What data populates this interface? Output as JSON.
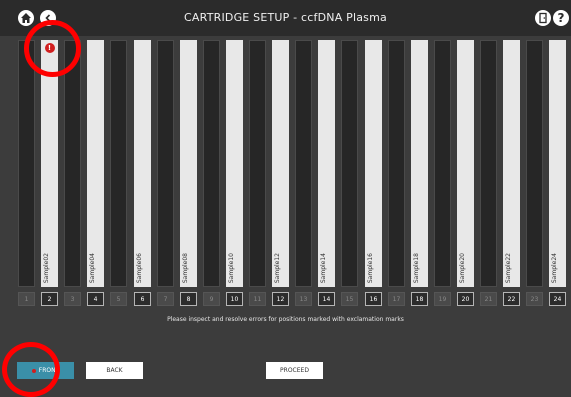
{
  "header": {
    "title": "CARTRIDGE SETUP - ccfDNA Plasma"
  },
  "lanes": [
    {
      "position": "1",
      "label": ""
    },
    {
      "position": "2",
      "label": "Sample02",
      "error": true
    },
    {
      "position": "3",
      "label": ""
    },
    {
      "position": "4",
      "label": "Sample04"
    },
    {
      "position": "5",
      "label": ""
    },
    {
      "position": "6",
      "label": "Sample06"
    },
    {
      "position": "7",
      "label": ""
    },
    {
      "position": "8",
      "label": "Sample08"
    },
    {
      "position": "9",
      "label": ""
    },
    {
      "position": "10",
      "label": "Sample10"
    },
    {
      "position": "11",
      "label": ""
    },
    {
      "position": "12",
      "label": "Sample12"
    },
    {
      "position": "13",
      "label": ""
    },
    {
      "position": "14",
      "label": "Sample14"
    },
    {
      "position": "15",
      "label": ""
    },
    {
      "position": "16",
      "label": "Sample16"
    },
    {
      "position": "17",
      "label": ""
    },
    {
      "position": "18",
      "label": "Sample18"
    },
    {
      "position": "19",
      "label": ""
    },
    {
      "position": "20",
      "label": "Sample20"
    },
    {
      "position": "21",
      "label": ""
    },
    {
      "position": "22",
      "label": "Sample22"
    },
    {
      "position": "23",
      "label": ""
    },
    {
      "position": "24",
      "label": "Sample24"
    }
  ],
  "error_badge": "!",
  "help_glyph": "?",
  "message": "Please inspect and resolve errors for positions marked with exclamation marks",
  "buttons": {
    "front": "FRONT",
    "back": "BACK",
    "proceed": "PROCEED"
  },
  "colors": {
    "error": "#d11f1f",
    "front_button": "#3a8fa8",
    "annotation": "#ff0000"
  }
}
